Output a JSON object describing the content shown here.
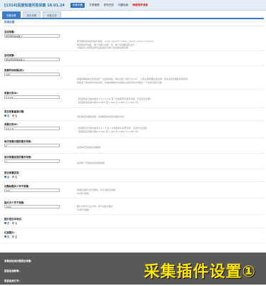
{
  "header": {
    "title": "[1314]百度知道问答采集 18.01.24",
    "nav": [
      "采集设置",
      "文章管理",
      "发布任务",
      "问题检索",
      "网络同步消息"
    ],
    "active_nav": 0
  },
  "tabs": {
    "items": [
      "采集设置",
      "发布设置",
      "采集过滤"
    ],
    "active": 0
  },
  "section_title": "采集设置",
  "form": {
    "collect_mode": {
      "label": "自动采集:",
      "value": "按问题自动采集",
      "desc": [
        "按问题标题关键词进行采集：plugin.php?id=addon_collect_zhidao:autocaiji",
        "网页版自动采集，每个问题只采集一次，每个问题都采集多次",
        "分组后可以按照关键词采集指定分组下的问题资源内容"
      ]
    },
    "auto_collect": {
      "label": "自动采集:",
      "value": "按关键词自动采集",
      "desc": []
    },
    "interval": {
      "label": "采集时间间隔(秒):",
      "value": "120",
      "desc": [
        "系统将每隔多长时间进行一次自动采集，单位为秒（默认为120），为防止服务器负载过重，建议设置合理的时间间隔",
        "如果选了按关键词自动采集，系统将每隔该时间段从关键词列表中取出一个关键词进行采集"
      ]
    },
    "categories": {
      "label": "采集分类ID:",
      "value": "1,2,3,4",
      "desc": [
        "【百度知道分类ID格式 1,2,3,4,5,6 多个分类用英文逗号分隔，为空时为全部】",
        "【百度知道问题分类ID 0-999 范 1-999 分 0-999 乃 2-999 为】"
      ]
    },
    "dedupe": {
      "label": "是否采集重复问题:",
      "options": [
        "是",
        "否"
      ],
      "selected": 0,
      "desc": "采集重复标题的问题，标题重复时将自动更新内容"
    },
    "category_ids2": {
      "label": "采集分类ID:",
      "value": "5,6,7,8",
      "desc": [
        "【百度知道分类ID格式 5,6,7,8 多个分类用英文逗号分隔，为空时为全部】",
        "【百度知道问题分类ID 0-999 范 1-999 分 0-999 乃 2-999 为】"
      ]
    },
    "min_answers": {
      "label": "每次采集问题的最多条数:",
      "value": "5",
      "desc": "设置每次自动采集的数量"
    },
    "max_answers": {
      "label": "每次采集回答的最多条数:",
      "value": "3",
      "desc": "设置每个问题采集的回答数量"
    },
    "collect_answers": {
      "label": "是否采集回答:",
      "options": [
        "是",
        "否"
      ],
      "selected": 0,
      "desc": ""
    },
    "title_length": {
      "label": "问题标题多少字不采集:",
      "value": "150",
      "desc": [
        "问题标题超过该字数时，将不采集该问题",
        "为0则不限制"
      ]
    },
    "content_length": {
      "label": "图片多少字不采集:",
      "value": "1000",
      "desc": [
        "图片文件尺寸过小时，将不采集该图片",
        "为0则不限制"
      ]
    },
    "image_download": {
      "label": "图片是否本地化:",
      "options": [
        "是",
        "否"
      ],
      "selected": 0,
      "desc": ""
    },
    "filter_images": {
      "label": "过滤图片:",
      "options": [
        "是",
        "否"
      ],
      "selected": 0,
      "desc": ""
    },
    "overlay_fields": [
      "采集前检测问题是否采集:",
      "回答检测频率:",
      "回答检测文字:"
    ]
  },
  "banner": "采集插件设置①",
  "colors": {
    "accent": "#3e7bc9",
    "banner": "#ffe600",
    "warn": "#d11111"
  }
}
